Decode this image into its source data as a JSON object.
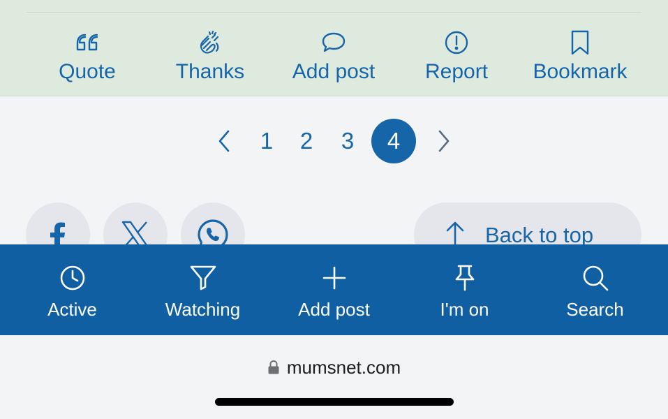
{
  "post_actions": [
    {
      "label": "Quote",
      "icon": "quote-icon"
    },
    {
      "label": "Thanks",
      "icon": "clapping-hands-icon"
    },
    {
      "label": "Add post",
      "icon": "speech-bubble-icon"
    },
    {
      "label": "Report",
      "icon": "exclamation-circle-icon"
    },
    {
      "label": "Bookmark",
      "icon": "bookmark-icon"
    }
  ],
  "pagination": {
    "pages": [
      "1",
      "2",
      "3",
      "4"
    ],
    "current": "4",
    "prev_icon": "chevron-left-icon",
    "next_icon": "chevron-right-icon"
  },
  "share": [
    {
      "name": "facebook",
      "icon": "facebook-icon"
    },
    {
      "name": "x",
      "icon": "x-logo-icon"
    },
    {
      "name": "whatsapp",
      "icon": "whatsapp-icon"
    }
  ],
  "back_to_top": {
    "label": "Back to top",
    "icon": "arrow-up-icon"
  },
  "bottom_nav": [
    {
      "label": "Active",
      "icon": "clock-icon"
    },
    {
      "label": "Watching",
      "icon": "filter-icon"
    },
    {
      "label": "Add post",
      "icon": "plus-icon"
    },
    {
      "label": "I'm on",
      "icon": "pin-icon"
    },
    {
      "label": "Search",
      "icon": "search-icon"
    }
  ],
  "browser": {
    "url": "mumsnet.com",
    "icon": "lock-icon"
  },
  "colors": {
    "brand": "#1565a8",
    "nav_bg": "#0f5fa2",
    "actions_bg": "#dfeadf",
    "page_bg": "#f3f4f6"
  }
}
